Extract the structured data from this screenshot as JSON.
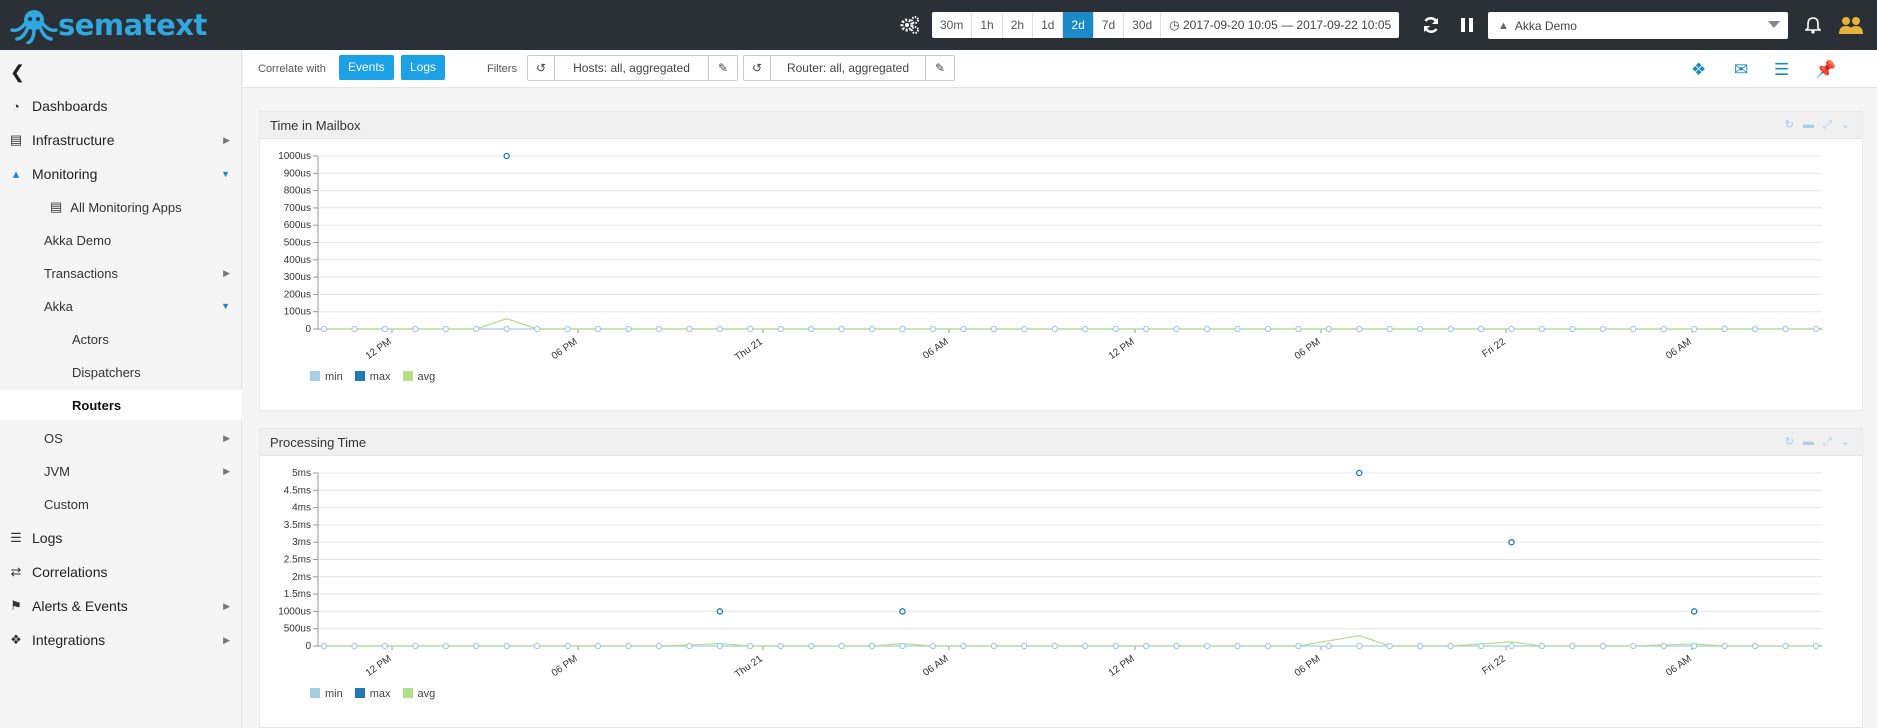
{
  "brand": {
    "name": "sematext"
  },
  "topbar": {
    "ranges": [
      "30m",
      "1h",
      "2h",
      "1d",
      "2d",
      "7d",
      "30d"
    ],
    "active_range": "2d",
    "date_range": "2017-09-20 10:05 — 2017-09-22 10:05",
    "app_selected": "Akka Demo"
  },
  "sidebar": {
    "items": [
      {
        "label": "Dashboards",
        "icon": "dashboard-icon"
      },
      {
        "label": "Infrastructure",
        "icon": "server-icon"
      },
      {
        "label": "Monitoring",
        "icon": "area-chart-icon"
      },
      {
        "label": "Logs",
        "icon": "list-icon"
      },
      {
        "label": "Correlations",
        "icon": "shuffle-icon"
      },
      {
        "label": "Alerts & Events",
        "icon": "flag-icon"
      },
      {
        "label": "Integrations",
        "icon": "cubes-icon"
      }
    ],
    "monitoring_sub": {
      "all_apps": "All Monitoring Apps",
      "akka_demo": "Akka Demo",
      "transactions": "Transactions",
      "akka": "Akka",
      "actors": "Actors",
      "dispatchers": "Dispatchers",
      "routers": "Routers",
      "os": "OS",
      "jvm": "JVM",
      "custom": "Custom"
    }
  },
  "toolbar": {
    "correlate_label": "Correlate with",
    "events_label": "Events",
    "logs_label": "Logs",
    "filters_label": "Filters",
    "hosts_filter": "Hosts: all, aggregated",
    "router_filter": "Router: all, aggregated"
  },
  "panels": [
    {
      "title": "Time in Mailbox"
    },
    {
      "title": "Processing Time"
    }
  ],
  "legend": {
    "min": "min",
    "max": "max",
    "avg": "avg"
  },
  "colors": {
    "min": "#a6cee3",
    "max": "#1f78b4",
    "avg": "#b2df8a",
    "accent": "#1aa1e6"
  },
  "chart_data": [
    {
      "type": "line",
      "title": "Time in Mailbox",
      "y_ticks": [
        "0",
        "100us",
        "200us",
        "300us",
        "400us",
        "500us",
        "600us",
        "700us",
        "800us",
        "900us",
        "1000us"
      ],
      "x_ticks": [
        "12 PM",
        "06 PM",
        "Thu 21",
        "06 AM",
        "12 PM",
        "06 PM",
        "Fri 22",
        "06 AM"
      ],
      "ylim": [
        0,
        1000
      ],
      "unit": "us",
      "points": 50,
      "series": [
        {
          "name": "min",
          "values": [
            0,
            0,
            0,
            0,
            0,
            0,
            0,
            0,
            0,
            0,
            0,
            0,
            0,
            0,
            0,
            0,
            0,
            0,
            0,
            0,
            0,
            0,
            0,
            0,
            0,
            0,
            0,
            0,
            0,
            0,
            0,
            0,
            0,
            0,
            0,
            0,
            0,
            0,
            0,
            0,
            0,
            0,
            0,
            0,
            0,
            0,
            0,
            0,
            0,
            0
          ]
        },
        {
          "name": "max",
          "values": [
            0,
            0,
            0,
            0,
            0,
            0,
            1000,
            0,
            0,
            0,
            0,
            0,
            0,
            0,
            0,
            0,
            0,
            0,
            0,
            0,
            0,
            0,
            0,
            0,
            0,
            0,
            0,
            0,
            0,
            0,
            0,
            0,
            0,
            0,
            0,
            0,
            0,
            0,
            0,
            0,
            0,
            0,
            0,
            0,
            0,
            0,
            0,
            0,
            0,
            0
          ]
        },
        {
          "name": "avg",
          "values": [
            0,
            0,
            0,
            0,
            0,
            0,
            60,
            0,
            0,
            0,
            0,
            0,
            0,
            0,
            0,
            0,
            0,
            0,
            0,
            0,
            0,
            0,
            0,
            0,
            0,
            0,
            0,
            0,
            0,
            0,
            0,
            0,
            0,
            0,
            0,
            0,
            0,
            0,
            0,
            0,
            0,
            0,
            0,
            0,
            0,
            0,
            0,
            0,
            0,
            0
          ]
        }
      ]
    },
    {
      "type": "line",
      "title": "Processing Time",
      "y_ticks": [
        "0",
        "500us",
        "1000us",
        "1.5ms",
        "2ms",
        "2.5ms",
        "3ms",
        "3.5ms",
        "4ms",
        "4.5ms",
        "5ms"
      ],
      "x_ticks": [
        "12 PM",
        "06 PM",
        "Thu 21",
        "06 AM",
        "12 PM",
        "06 PM",
        "Fri 22",
        "06 AM"
      ],
      "ylim": [
        0,
        5
      ],
      "unit": "ms",
      "points": 50,
      "series": [
        {
          "name": "min",
          "values": [
            0,
            0,
            0,
            0,
            0,
            0,
            0,
            0,
            0,
            0,
            0,
            0,
            0,
            0,
            0,
            0,
            0,
            0,
            0,
            0,
            0,
            0,
            0,
            0,
            0,
            0,
            0,
            0,
            0,
            0,
            0,
            0,
            0,
            0,
            0,
            0,
            0,
            0,
            0,
            0,
            0,
            0,
            0,
            0,
            0,
            0,
            0,
            0,
            0,
            0
          ]
        },
        {
          "name": "max",
          "values": [
            0,
            0,
            0,
            0,
            0,
            0,
            0,
            0,
            0,
            0,
            0,
            0,
            0,
            1,
            0,
            0,
            0,
            0,
            0,
            1,
            0,
            0,
            0,
            0,
            0,
            0,
            0,
            0,
            0,
            0,
            0,
            0,
            0,
            0,
            5,
            0,
            0,
            0,
            0,
            3,
            0,
            0,
            0,
            0,
            0,
            1,
            0,
            0,
            0,
            0
          ]
        },
        {
          "name": "avg",
          "values": [
            0,
            0,
            0,
            0,
            0,
            0,
            0,
            0,
            0,
            0,
            0,
            0,
            0.03,
            0.07,
            0,
            0,
            0,
            0,
            0,
            0.07,
            0,
            0,
            0,
            0,
            0,
            0,
            0,
            0,
            0,
            0,
            0,
            0,
            0,
            0.15,
            0.3,
            0,
            0,
            0,
            0.06,
            0.12,
            0,
            0,
            0,
            0,
            0.03,
            0.06,
            0,
            0,
            0,
            0
          ]
        }
      ]
    }
  ]
}
